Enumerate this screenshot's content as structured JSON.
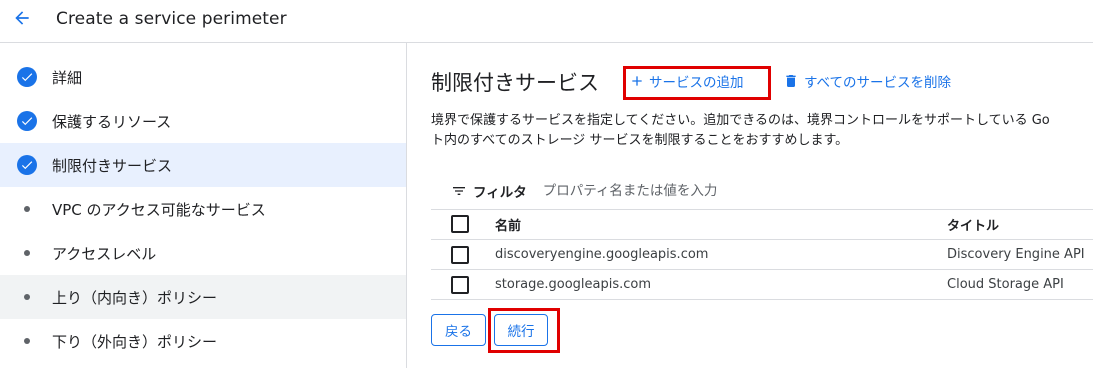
{
  "header": {
    "title": "Create a service perimeter",
    "back_icon": "arrow-back-icon"
  },
  "colors": {
    "accent": "#1a73e8",
    "active_step_bg": "#e8f0fe",
    "highlight": "#e00000"
  },
  "sidebar": {
    "steps": [
      {
        "label": "詳細",
        "status": "complete"
      },
      {
        "label": "保護するリソース",
        "status": "complete"
      },
      {
        "label": "制限付きサービス",
        "status": "complete",
        "active": true
      },
      {
        "label": "VPC のアクセス可能なサービス",
        "status": "pending"
      },
      {
        "label": "アクセスレベル",
        "status": "pending"
      },
      {
        "label": "上り（内向き）ポリシー",
        "status": "pending"
      },
      {
        "label": "下り（外向き）ポリシー",
        "status": "pending"
      }
    ]
  },
  "main": {
    "section_title": "制限付きサービス",
    "add_service_label": "サービスの追加",
    "delete_all_label": "すべてのサービスを削除",
    "description_line1": "境界で保護するサービスを指定してください。追加できるのは、境界コントロールをサポートしている Go",
    "description_line2": "ト内のすべてのストレージ サービスを制限することをおすすめします。",
    "filter": {
      "label": "フィルタ",
      "placeholder": "プロパティ名または値を入力"
    },
    "table": {
      "columns": {
        "name": "名前",
        "title": "タイトル"
      },
      "rows": [
        {
          "name": "discoveryengine.googleapis.com",
          "title": "Discovery Engine API"
        },
        {
          "name": "storage.googleapis.com",
          "title": "Cloud Storage API"
        }
      ]
    },
    "buttons": {
      "back": "戻る",
      "continue": "続行"
    }
  }
}
